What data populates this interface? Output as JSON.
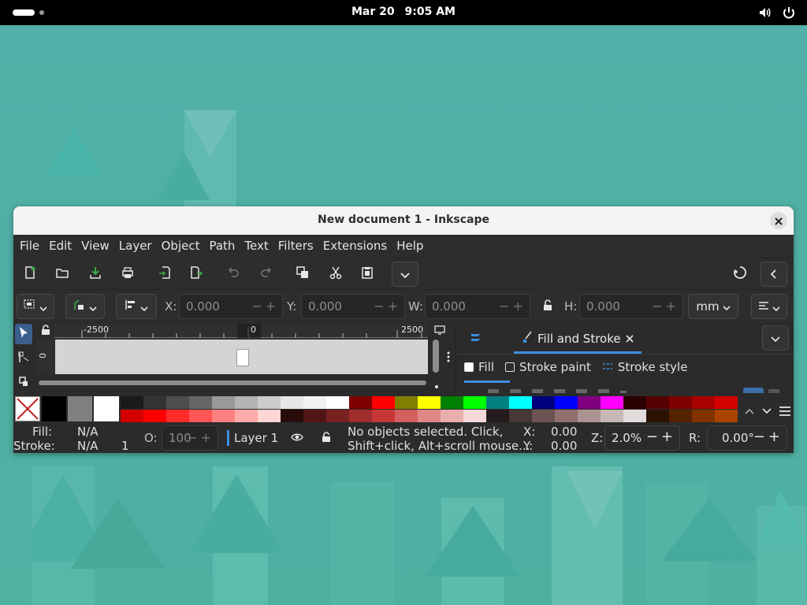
{
  "topbar": {
    "date": "Mar 20",
    "time": "9:05 AM"
  },
  "window": {
    "title": "New document 1 - Inkscape"
  },
  "menu": [
    "File",
    "Edit",
    "View",
    "Layer",
    "Object",
    "Path",
    "Text",
    "Filters",
    "Extensions",
    "Help"
  ],
  "toolbar2": {
    "x_label": "X:",
    "x_value": "0.000",
    "y_label": "Y:",
    "y_value": "0.000",
    "w_label": "W:",
    "w_value": "0.000",
    "h_label": "H:",
    "h_value": "0.000",
    "unit": "mm"
  },
  "ruler": {
    "labels": [
      "-2500",
      "0",
      "2500"
    ],
    "v_label": "0"
  },
  "dock": {
    "active_tab": "Fill and Stroke",
    "subtabs": [
      "Fill",
      "Stroke paint",
      "Stroke style"
    ]
  },
  "palette": {
    "top_row": [
      "#1a1a1a",
      "#333333",
      "#4d4d4d",
      "#666666",
      "#999999",
      "#b3b3b3",
      "#cccccc",
      "#e6e6e6",
      "#f2f2f2",
      "#ffffff",
      "#800000",
      "#ff0000",
      "#808000",
      "#ffff00",
      "#008000",
      "#00ff00",
      "#008080",
      "#00ffff",
      "#000080",
      "#0000ff",
      "#800080",
      "#ff00ff",
      "#2b0000",
      "#550000",
      "#800000",
      "#aa0000",
      "#d40000"
    ],
    "bottom_row": [
      "#d40000",
      "#ff0000",
      "#ff2a2a",
      "#ff5555",
      "#ff8080",
      "#ffaaaa",
      "#ffd5d5",
      "#280b0b",
      "#501616",
      "#782121",
      "#a02c2c",
      "#c83737",
      "#d35f5f",
      "#de8787",
      "#e9afaf",
      "#f4d7d7",
      "#241c1c",
      "#483737",
      "#6c5353",
      "#916f6f",
      "#ac9393",
      "#c8b7b7",
      "#e3dbdb",
      "#2b1100",
      "#552200",
      "#803300",
      "#aa4400"
    ]
  },
  "status": {
    "fill_label": "Fill:",
    "fill_value": "N/A",
    "stroke_label": "Stroke:",
    "stroke_value": "N/A",
    "stroke_width": "1",
    "opacity_label": "O:",
    "opacity_value": "100",
    "layer": "Layer 1",
    "message_line1": "No objects selected. Click,",
    "message_line2": "Shift+click, Alt+scroll mouse...",
    "x_label": "X:",
    "x_value": "0.00",
    "y_label": "Y:",
    "y_value": "0.00",
    "zoom_label": "Z:",
    "zoom_value": "2.0%",
    "rotation_label": "R:",
    "rotation_value": "0.00°"
  }
}
